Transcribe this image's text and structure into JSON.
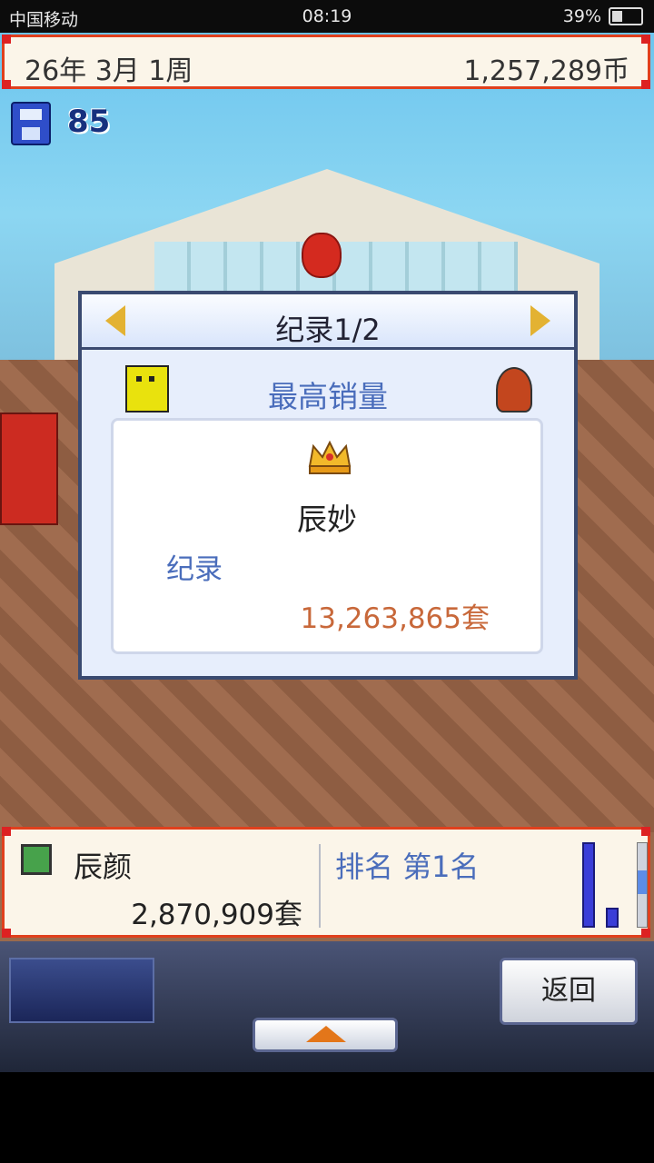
{
  "status_bar": {
    "carrier": "中国移动",
    "time": "08:19",
    "battery_percent": "39%"
  },
  "top_bar": {
    "date": "26年 3月 1周",
    "money": "1,257,289币"
  },
  "save_counter": "85",
  "dialog": {
    "title": "纪录1/2",
    "subtitle": "最高销量",
    "winner_name": "辰妙",
    "record_label": "纪录",
    "record_value": "13,263,865套"
  },
  "bottom_panel": {
    "game_name": "辰颜",
    "game_sales": "2,870,909套",
    "ranking": "排名 第1名"
  },
  "buttons": {
    "back": "返回"
  },
  "colors": {
    "frame_red": "#e0401d",
    "dialog_blue": "#4a6dbb",
    "record_orange": "#c8683a"
  },
  "icons": [
    "save-icon",
    "arrow-left-icon",
    "arrow-right-icon",
    "crown-icon",
    "up-arrow-icon"
  ]
}
